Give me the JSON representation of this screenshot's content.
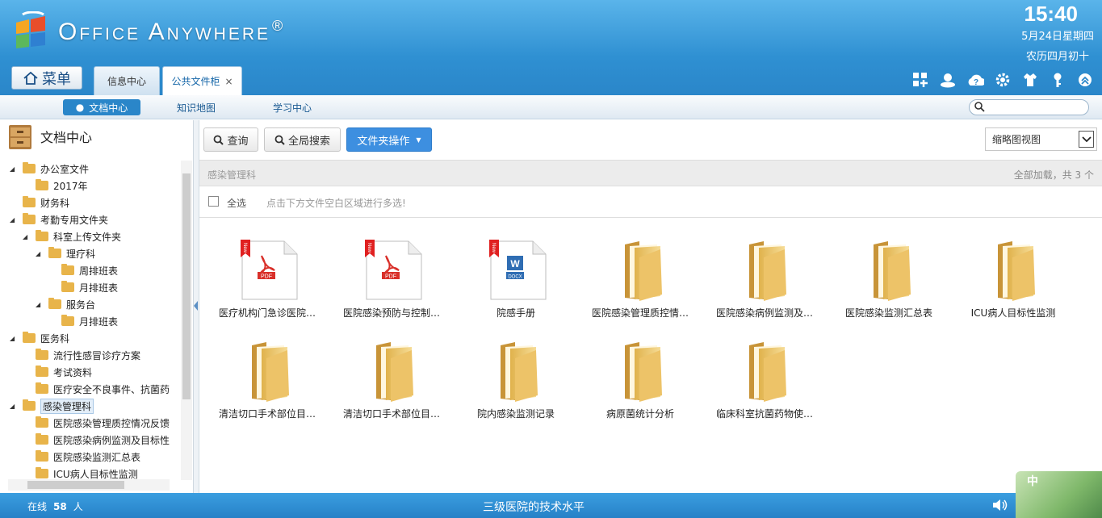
{
  "header": {
    "brand": "Office Anywhere",
    "reg": "®",
    "clock": "15:40",
    "date": "5月24日星期四",
    "lunar": "农历四月初十"
  },
  "menu_label": "菜单",
  "tabs": [
    {
      "label": "信息中心"
    },
    {
      "label": "公共文件柜",
      "close": "×"
    }
  ],
  "subnav": {
    "items": [
      "文档中心",
      "知识地图",
      "学习中心"
    ]
  },
  "sidebar": {
    "title": "文档中心",
    "tree": [
      "办公室文件",
      "2017年",
      "财务科",
      "考勤专用文件夹",
      "科室上传文件夹",
      "理疗科",
      "周排班表",
      "月排班表",
      "服务台",
      "月排班表",
      "医务科",
      "流行性感冒诊疗方案",
      "考试资料",
      "医疗安全不良事件、抗菌药",
      "感染管理科",
      "医院感染管理质控情况反馈",
      "医院感染病例监测及目标性",
      "医院感染监测汇总表",
      "ICU病人目标性监测"
    ]
  },
  "toolbar": {
    "query": "查询",
    "global_search": "全局搜索",
    "folder_ops": "文件夹操作",
    "view": "缩略图视图"
  },
  "path": {
    "current": "感染管理科",
    "load_info": "全部加载，共 3 个"
  },
  "select": {
    "all": "全选",
    "tip": "点击下方文件空白区域进行多选!"
  },
  "files": [
    {
      "name": "医疗机构门急诊医院…",
      "type": "PDF"
    },
    {
      "name": "医院感染预防与控制…",
      "type": "PDF"
    },
    {
      "name": "院感手册",
      "type": "DOCX"
    },
    {
      "name": "医院感染管理质控情…",
      "type": "folder"
    },
    {
      "name": "医院感染病例监测及…",
      "type": "folder"
    },
    {
      "name": "医院感染监测汇总表",
      "type": "folder"
    },
    {
      "name": "ICU病人目标性监测",
      "type": "folder"
    },
    {
      "name": "清洁切口手术部位目…",
      "type": "folder"
    },
    {
      "name": "清洁切口手术部位目…",
      "type": "folder"
    },
    {
      "name": "院内感染监测记录",
      "type": "folder"
    },
    {
      "name": "病原菌统计分析",
      "type": "folder"
    },
    {
      "name": "临床科室抗菌药物使…",
      "type": "folder"
    }
  ],
  "new_badge": "New",
  "status": {
    "online_label": "在线",
    "online_count": "58",
    "online_unit": "人",
    "marquee": "三级医院的技术水平"
  },
  "ime": {
    "label": "中"
  }
}
